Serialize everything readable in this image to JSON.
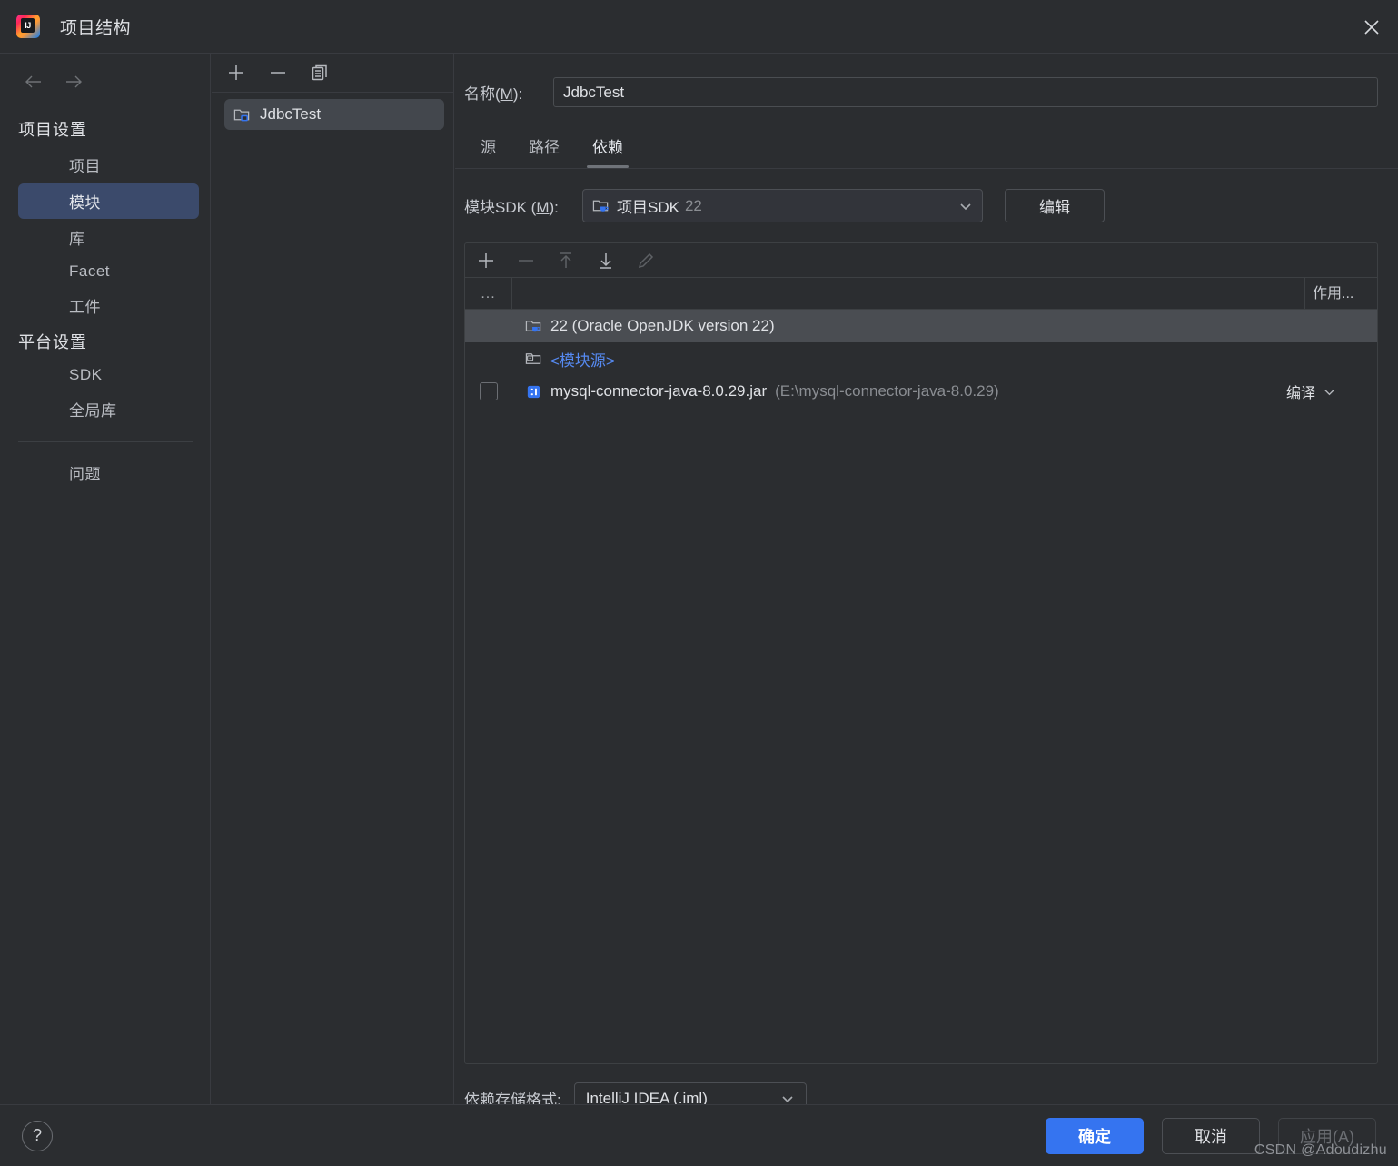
{
  "window": {
    "title": "项目结构",
    "logo_text": "IJ",
    "close_icon": "close-icon"
  },
  "nav": {
    "back_icon": "arrow-left-icon",
    "forward_icon": "arrow-right-icon"
  },
  "sidebar": {
    "groups": [
      {
        "title": "项目设置",
        "items": [
          {
            "label": "项目",
            "selected": false
          },
          {
            "label": "模块",
            "selected": true
          },
          {
            "label": "库",
            "selected": false
          },
          {
            "label": "Facet",
            "selected": false
          },
          {
            "label": "工件",
            "selected": false
          }
        ]
      },
      {
        "title": "平台设置",
        "items": [
          {
            "label": "SDK",
            "selected": false
          },
          {
            "label": "全局库",
            "selected": false
          }
        ]
      }
    ],
    "footer_items": [
      {
        "label": "问题",
        "selected": false
      }
    ],
    "selected_color": "#3b4a6b"
  },
  "modules_panel": {
    "toolbar": [
      {
        "name": "add-module-button",
        "icon": "plus-icon",
        "enabled": true
      },
      {
        "name": "remove-module-button",
        "icon": "minus-icon",
        "enabled": true
      },
      {
        "name": "copy-module-button",
        "icon": "copy-icon",
        "enabled": true
      }
    ],
    "items": [
      {
        "label": "JdbcTest",
        "icon": "module-folder-icon",
        "selected": true
      }
    ]
  },
  "main": {
    "name_label": "名称(",
    "name_mnemonic": "M",
    "name_label_tail": "):",
    "name_value": "JdbcTest",
    "name_placeholder": "",
    "tabs": [
      {
        "label": "源",
        "active": false
      },
      {
        "label": "路径",
        "active": false
      },
      {
        "label": "依赖",
        "active": true
      }
    ],
    "sdk": {
      "label_head": "模块SDK (",
      "label_mnemonic": "M",
      "label_tail": "):",
      "value": "项目SDK",
      "version": "22",
      "icon": "sdk-folder-icon",
      "chevron": "chevron-down-icon",
      "edit_button": "编辑"
    },
    "dep_toolbar": [
      {
        "name": "add-dependency-button",
        "icon": "plus-icon",
        "enabled": true
      },
      {
        "name": "remove-dependency-button",
        "icon": "minus-icon",
        "enabled": false
      },
      {
        "name": "move-up-button",
        "icon": "arrow-up-bar-icon",
        "enabled": false
      },
      {
        "name": "move-down-button",
        "icon": "arrow-down-bar-icon",
        "enabled": true
      },
      {
        "name": "edit-dependency-button",
        "icon": "pencil-icon",
        "enabled": false
      }
    ],
    "dep_table": {
      "columns": {
        "export": "...",
        "name": "",
        "scope": "作用..."
      },
      "rows": [
        {
          "checkbox": false,
          "has_checkbox": false,
          "icon": "jdk-icon",
          "name": "22 (Oracle OpenJDK version 22)",
          "path": "",
          "scope": "",
          "selected": true,
          "link": false
        },
        {
          "checkbox": false,
          "has_checkbox": false,
          "icon": "module-source-icon",
          "name": "<模块源>",
          "path": "",
          "scope": "",
          "selected": false,
          "link": true
        },
        {
          "checkbox": false,
          "has_checkbox": true,
          "icon": "jar-icon",
          "name": "mysql-connector-java-8.0.29.jar",
          "path": "(E:\\mysql-connector-java-8.0.29)",
          "scope": "编译",
          "selected": false,
          "link": false
        }
      ]
    },
    "storage": {
      "label": "依赖存储格式:",
      "value": "IntelliJ IDEA (.iml)",
      "chevron": "chevron-down-icon"
    }
  },
  "footer": {
    "help_icon": "question-mark-icon",
    "ok": "确定",
    "cancel": "取消",
    "apply": "应用(A)",
    "apply_enabled": false,
    "primary_color": "#3574f0"
  },
  "watermark": "CSDN @Adoudizhu"
}
